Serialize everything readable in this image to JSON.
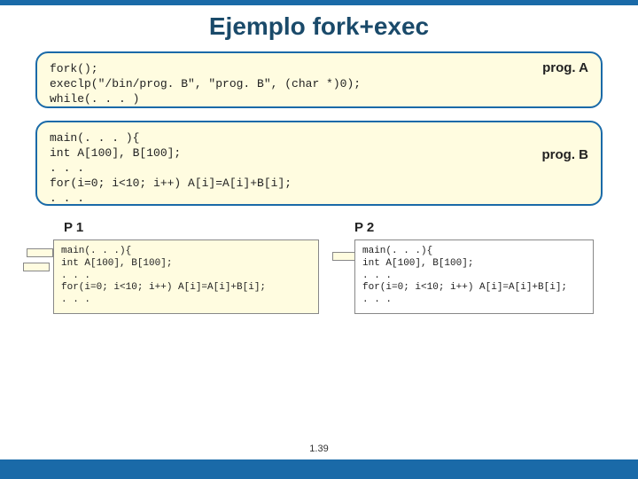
{
  "title": "Ejemplo fork+exec",
  "boxA": {
    "label": "prog. A",
    "code": "fork();\nexeclp(\"/bin/prog. B\", \"prog. B\", (char *)0);\nwhile(. . . )"
  },
  "boxB": {
    "label": "prog. B",
    "code": "main(. . . ){\nint A[100], B[100];\n. . .\nfor(i=0; i<10; i++) A[i]=A[i]+B[i];\n. . ."
  },
  "p1": {
    "label": "P 1",
    "code": "main(. . .){\nint A[100], B[100];\n. . .\nfor(i=0; i<10; i++) A[i]=A[i]+B[i];\n. . ."
  },
  "p2": {
    "label": "P 2",
    "code": "main(. . .){\nint A[100], B[100];\n. . .\nfor(i=0; i<10; i++) A[i]=A[i]+B[i];\n. . ."
  },
  "pageNumber": "1.39"
}
